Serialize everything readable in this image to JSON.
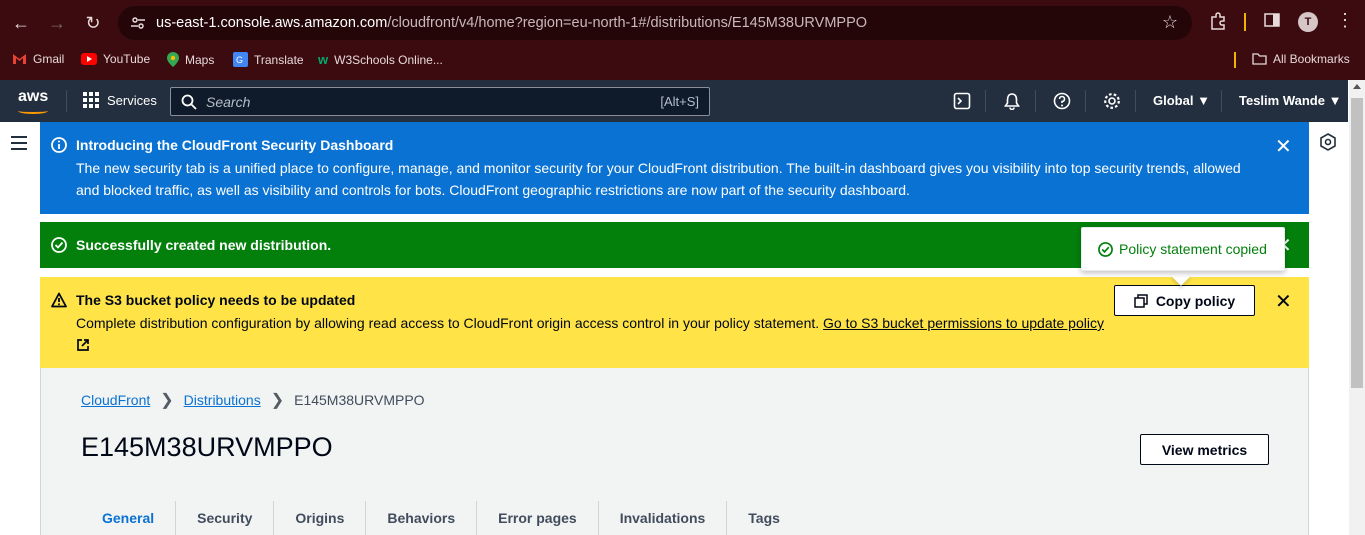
{
  "browser": {
    "url_host": "us-east-1.console.aws.amazon.com",
    "url_path": "/cloudfront/v4/home?region=eu-north-1#/distributions/E145M38URVMPPO",
    "profile_initial": "T",
    "bookmarks": [
      {
        "label": "Gmail",
        "icon": "gmail-icon",
        "color": "#ea4335"
      },
      {
        "label": "YouTube",
        "icon": "youtube-icon",
        "color": "#ff0000"
      },
      {
        "label": "Maps",
        "icon": "maps-icon",
        "color": "#34a853"
      },
      {
        "label": "Translate",
        "icon": "translate-icon",
        "color": "#4285f4"
      },
      {
        "label": "W3Schools Online...",
        "icon": "w3schools-icon",
        "color": "#04aa6d"
      }
    ],
    "all_bookmarks": "All Bookmarks"
  },
  "aws_header": {
    "logo": "aws",
    "services": "Services",
    "search_placeholder": "Search",
    "search_shortcut": "[Alt+S]",
    "region": "Global",
    "user": "Teslim Wande"
  },
  "flash_info": {
    "title": "Introducing the CloudFront Security Dashboard",
    "body": "The new security tab is a unified place to configure, manage, and monitor security for your CloudFront distribution. The built-in dashboard gives you visibility into top security trends, allowed and blocked traffic, as well as visibility and controls for bots. CloudFront geographic restrictions are now part of the security dashboard."
  },
  "flash_success": {
    "title": "Successfully created new distribution."
  },
  "flash_warning": {
    "title": "The S3 bucket policy needs to be updated",
    "body": "Complete distribution configuration by allowing read access to CloudFront origin access control in your policy statement.",
    "link": "Go to S3 bucket permissions to update policy",
    "button": "Copy policy"
  },
  "popover": {
    "text": "Policy statement copied"
  },
  "breadcrumbs": [
    "CloudFront",
    "Distributions",
    "E145M38URVMPPO"
  ],
  "page_title": "E145M38URVMPPO",
  "view_metrics": "View metrics",
  "tabs": [
    "General",
    "Security",
    "Origins",
    "Behaviors",
    "Error pages",
    "Invalidations",
    "Tags"
  ],
  "colors": {
    "info": "#0972d3",
    "success": "#037f0c",
    "warning": "#ffe347",
    "aws_header": "#232f3e",
    "browser_frame": "#3b0b0f"
  }
}
